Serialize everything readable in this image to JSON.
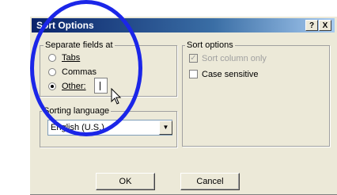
{
  "window": {
    "title": "Sort Options",
    "help_label": "?",
    "close_label": "X"
  },
  "separate_fields": {
    "title": "Separate fields at",
    "options": [
      {
        "label": "Tabs",
        "selected": false
      },
      {
        "label": "Commas",
        "selected": false
      },
      {
        "label": "Other:",
        "selected": true
      }
    ],
    "other_value": ""
  },
  "sort_options": {
    "title": "Sort options",
    "sort_column_only": {
      "label": "Sort column only",
      "checked": true,
      "enabled": false
    },
    "case_sensitive": {
      "label": "Case sensitive",
      "checked": false,
      "enabled": true
    }
  },
  "sorting_language": {
    "title": "Sorting language",
    "selected": "English (U.S.)"
  },
  "buttons": {
    "ok": "OK",
    "cancel": "Cancel"
  },
  "annotation": {
    "circle_color": "#1b26e8"
  }
}
